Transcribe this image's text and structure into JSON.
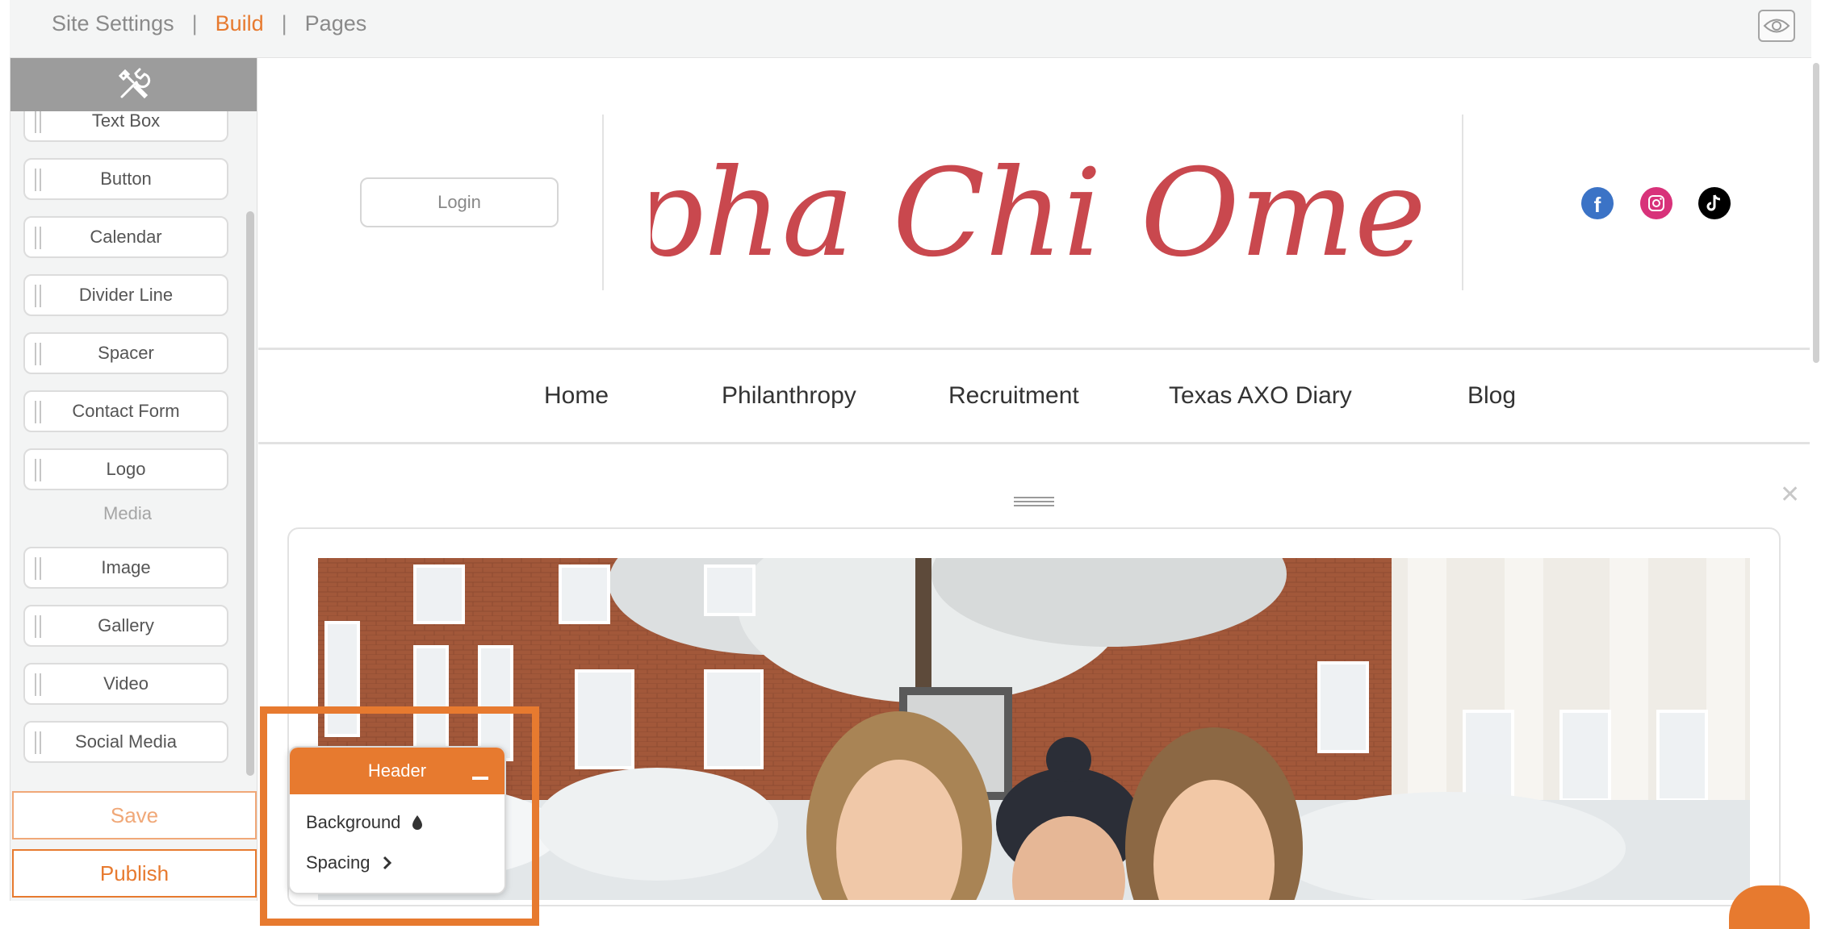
{
  "topbar": {
    "tabs": [
      "Site Settings",
      "Build",
      "Pages"
    ],
    "separator": "|",
    "active_tab": "Build",
    "preview_icon": "eye-icon"
  },
  "sidebar": {
    "header_icon": "tools-icon",
    "widgets": [
      "Text Box",
      "Button",
      "Calendar",
      "Divider Line",
      "Spacer",
      "Contact Form",
      "Logo"
    ],
    "media_section": "Media",
    "media_widgets": [
      "Image",
      "Gallery",
      "Video",
      "Social Media"
    ],
    "save_label": "Save",
    "publish_label": "Publish"
  },
  "site": {
    "login_label": "Login",
    "logo_text": "Alpha Chi Omega",
    "social_icons": [
      "facebook-icon",
      "instagram-icon",
      "tiktok-icon"
    ],
    "nav": [
      "Home",
      "Philanthropy",
      "Recruitment",
      "Texas AXO Diary",
      "Blog"
    ]
  },
  "popup": {
    "title": "Header",
    "items": [
      "Background",
      "Spacing"
    ]
  },
  "colors": {
    "accent": "#e77a2f",
    "logo": "#c9484e",
    "facebook": "#3b73c6",
    "instagram": "#d8327a",
    "tiktok": "#000000"
  }
}
